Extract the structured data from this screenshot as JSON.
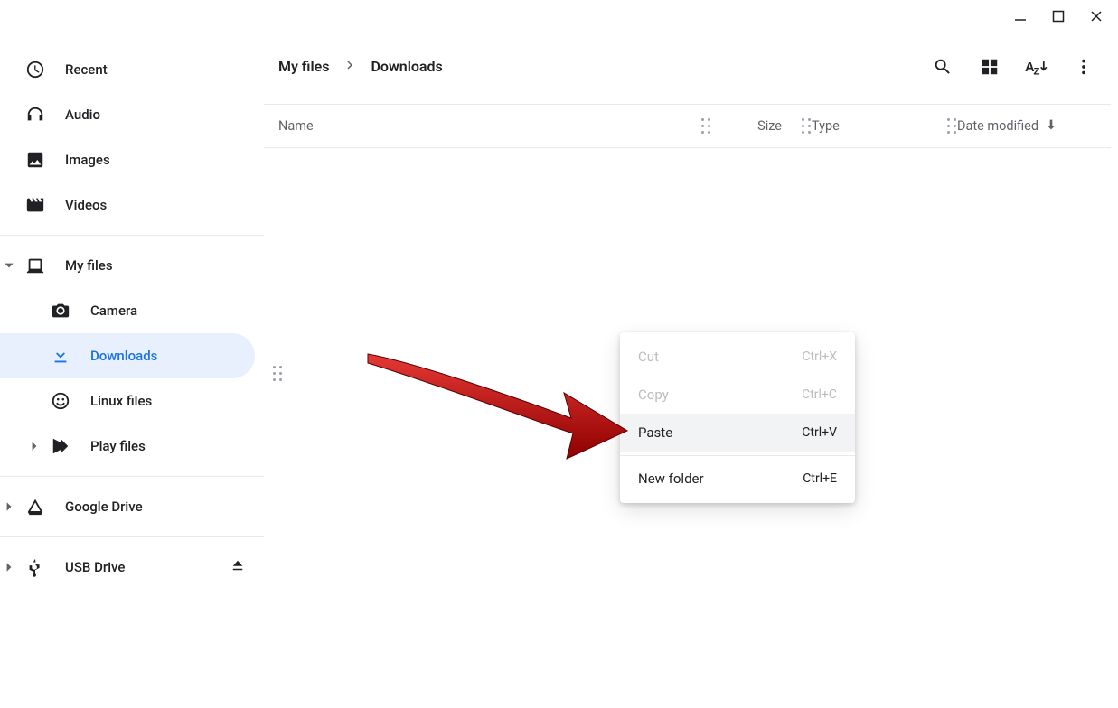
{
  "window_controls": {
    "minimize": "minimize",
    "maximize": "maximize",
    "close": "close"
  },
  "sidebar": {
    "quick": [
      {
        "icon": "clock-icon",
        "label": "Recent"
      },
      {
        "icon": "headphones-icon",
        "label": "Audio"
      },
      {
        "icon": "picture-icon",
        "label": "Images"
      },
      {
        "icon": "clapper-icon",
        "label": "Videos"
      }
    ],
    "myfiles": {
      "label": "My files",
      "children": [
        {
          "icon": "camera-icon",
          "label": "Camera"
        },
        {
          "icon": "download-icon",
          "label": "Downloads",
          "selected": true
        },
        {
          "icon": "linux-icon",
          "label": "Linux files"
        },
        {
          "icon": "play-icon",
          "label": "Play files",
          "expandable": true
        }
      ]
    },
    "drive": {
      "label": "Google Drive"
    },
    "usb": {
      "label": "USB Drive"
    }
  },
  "breadcrumb": {
    "root": "My files",
    "current": "Downloads"
  },
  "toolbar": {
    "search": "Search",
    "view": "Grid view",
    "sort": "Sort",
    "more": "More options"
  },
  "columns": {
    "name": "Name",
    "size": "Size",
    "type": "Type",
    "date": "Date modified"
  },
  "context_menu": {
    "items": [
      {
        "label": "Cut",
        "shortcut": "Ctrl+X",
        "disabled": true
      },
      {
        "label": "Copy",
        "shortcut": "Ctrl+C",
        "disabled": true
      },
      {
        "label": "Paste",
        "shortcut": "Ctrl+V",
        "hover": true
      },
      {
        "sep": true
      },
      {
        "label": "New folder",
        "shortcut": "Ctrl+E"
      }
    ]
  }
}
